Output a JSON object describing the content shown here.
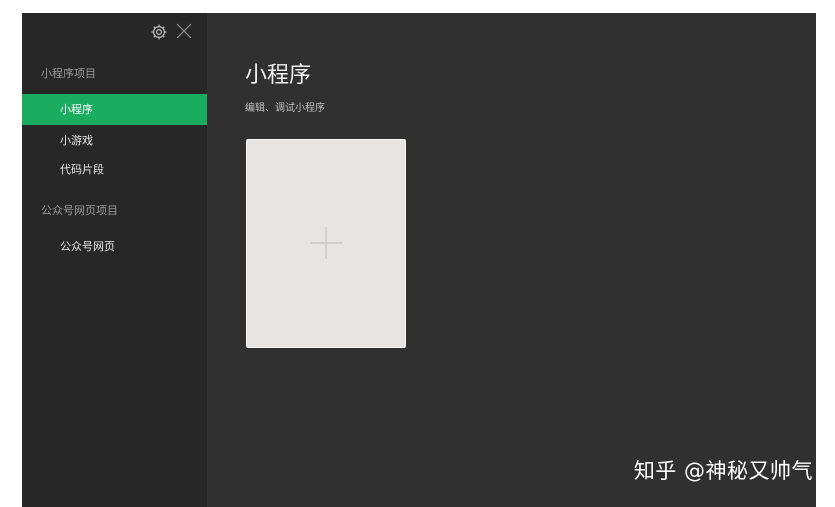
{
  "sidebar": {
    "toolbar": {
      "settings_icon": "gear-icon",
      "close_icon": "close-icon"
    },
    "sections": [
      {
        "title": "小程序项目",
        "items": [
          {
            "label": "小程序",
            "active": true
          },
          {
            "label": "小游戏",
            "active": false
          },
          {
            "label": "代码片段",
            "active": false
          }
        ]
      },
      {
        "title": "公众号网页项目",
        "items": [
          {
            "label": "公众号网页",
            "active": false
          }
        ]
      }
    ]
  },
  "main": {
    "title": "小程序",
    "subtitle": "编辑、调试小程序",
    "add_card_icon": "plus-icon"
  },
  "watermark": "知乎 @神秘又帅气",
  "colors": {
    "accent": "#1aad5f",
    "sidebar_bg": "#262726",
    "main_bg": "#2f302f",
    "card_bg": "#e6e5e4"
  }
}
